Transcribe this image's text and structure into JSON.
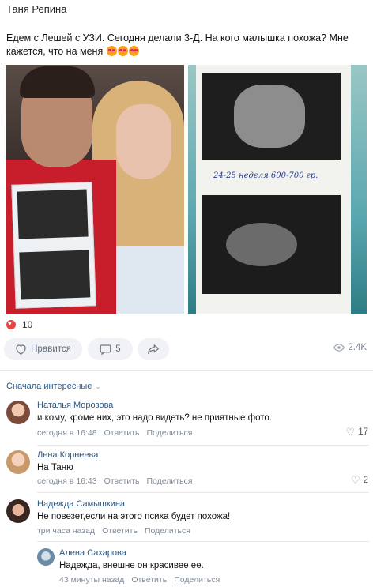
{
  "post": {
    "author": "Таня Репина",
    "text": "Едем с Лешей с УЗИ. Сегодня делали 3-Д. На кого малышка похожа? Мне кажется, что на меня",
    "emojis": [
      "heart-eyes-emoji",
      "heart-eyes-emoji",
      "heart-eyes-emoji"
    ],
    "photo_handwriting": "24-25 неделя  600-700 гр.",
    "likes_count": "10",
    "like_button_label": "Нравится",
    "comments_count": "5",
    "views": "2.4K"
  },
  "comments_sort": "Сначала интересные",
  "comments": [
    {
      "name": "Наталья Морозова",
      "text": "и кому, кроме них, это надо видеть? не приятные фото.",
      "time": "сегодня в 16:48",
      "reply": "Ответить",
      "share": "Поделиться",
      "likes": "17"
    },
    {
      "name": "Лена Корнеева",
      "text": "На Таню",
      "time": "сегодня в 16:43",
      "reply": "Ответить",
      "share": "Поделиться",
      "likes": "2"
    },
    {
      "name": "Надежда Самышкина",
      "text": "Не повезет,если на этого психа будет похожа!",
      "time": "три часа назад",
      "reply": "Ответить",
      "share": "Поделиться",
      "likes": ""
    }
  ],
  "reply_comment": {
    "name": "Алена Сахарова",
    "text": "Надежда, внешне он красивее ее.",
    "time": "43 минуты назад",
    "reply": "Ответить",
    "share": "Поделиться"
  },
  "colors": {
    "link": "#2a5885",
    "meta": "#818c99",
    "like_red": "#e64646",
    "button_bg": "#f0f2f5"
  }
}
